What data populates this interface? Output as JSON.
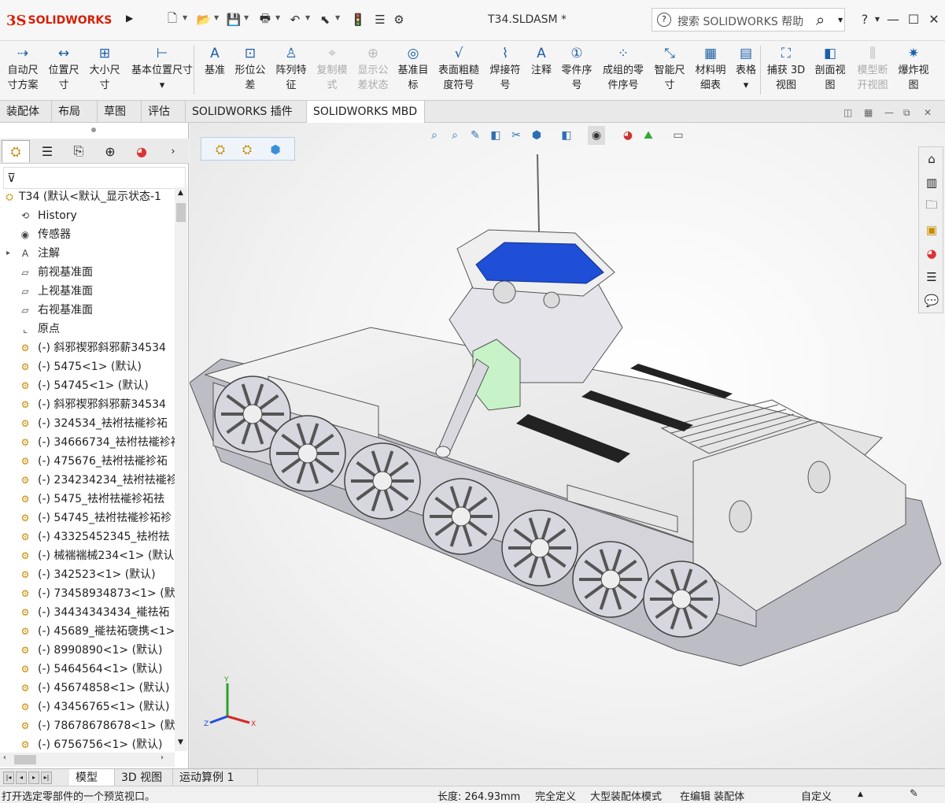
{
  "app": {
    "logo_ds": "3S",
    "logo_text": "SOLIDWORKS",
    "document_title": "T34.SLDASM *",
    "search_placeholder": "搜索 SOLIDWORKS 帮助",
    "help_label": "?"
  },
  "quick_access": [
    {
      "name": "new-document-icon",
      "glyph": "🗋"
    },
    {
      "name": "open-document-icon",
      "glyph": "📂"
    },
    {
      "name": "save-icon",
      "glyph": "💾"
    },
    {
      "name": "print-icon",
      "glyph": "🖶"
    },
    {
      "name": "undo-icon",
      "glyph": "↶"
    },
    {
      "name": "select-icon",
      "glyph": "⬉"
    },
    {
      "name": "rebuild-icon",
      "glyph": "🚦"
    },
    {
      "name": "file-properties-icon",
      "glyph": "☰"
    },
    {
      "name": "options-icon",
      "glyph": "⚙"
    }
  ],
  "commands": [
    {
      "l1": "自动尺",
      "l2": "寸方案",
      "icon": "auto-dimension-icon",
      "glyph": "⇢",
      "disabled": false
    },
    {
      "l1": "位置尺",
      "l2": "寸",
      "icon": "location-dimension-icon",
      "glyph": "↔",
      "disabled": false
    },
    {
      "l1": "大小尺",
      "l2": "寸",
      "icon": "size-dimension-icon",
      "glyph": "⊞",
      "disabled": false
    },
    {
      "l1": "基本位置尺寸",
      "l2": "▾",
      "icon": "basic-location-dimension-icon",
      "glyph": "⊢",
      "disabled": false
    },
    {
      "l1": "基准",
      "l2": "",
      "icon": "datum-icon",
      "glyph": "A",
      "disabled": false
    },
    {
      "l1": "形位公",
      "l2": "差",
      "icon": "geometric-tolerance-icon",
      "glyph": "⊡",
      "disabled": false
    },
    {
      "l1": "阵列特",
      "l2": "征",
      "icon": "pattern-feature-icon",
      "glyph": "♙",
      "disabled": false
    },
    {
      "l1": "复制模",
      "l2": "式",
      "icon": "copy-scheme-icon",
      "glyph": "⌖",
      "disabled": true
    },
    {
      "l1": "显示公",
      "l2": "差状态",
      "icon": "show-tolerance-status-icon",
      "glyph": "⊕",
      "disabled": true
    },
    {
      "l1": "基准目",
      "l2": "标",
      "icon": "datum-target-icon",
      "glyph": "◎",
      "disabled": false
    },
    {
      "l1": "表面粗糙",
      "l2": "度符号",
      "icon": "surface-finish-icon",
      "glyph": "√",
      "disabled": false
    },
    {
      "l1": "焊接符",
      "l2": "号",
      "icon": "weld-symbol-icon",
      "glyph": "⌇",
      "disabled": false
    },
    {
      "l1": "注释",
      "l2": "",
      "icon": "note-icon",
      "glyph": "A",
      "disabled": false
    },
    {
      "l1": "零件序",
      "l2": "号",
      "icon": "balloon-icon",
      "glyph": "①",
      "disabled": false
    },
    {
      "l1": "成组的零",
      "l2": "件序号",
      "icon": "stacked-balloon-icon",
      "glyph": "⁘",
      "disabled": false
    },
    {
      "l1": "智能尺",
      "l2": "寸",
      "icon": "smart-dimension-icon",
      "glyph": "⤡",
      "disabled": false
    },
    {
      "l1": "材料明",
      "l2": "细表",
      "icon": "bill-of-materials-icon",
      "glyph": "▦",
      "disabled": false
    },
    {
      "l1": "表格",
      "l2": "▾",
      "icon": "table-icon",
      "glyph": "▤",
      "disabled": false
    },
    {
      "l1": "捕获 3D",
      "l2": "视图",
      "icon": "capture-3d-view-icon",
      "glyph": "⛶",
      "disabled": false
    },
    {
      "l1": "剖面视",
      "l2": "图",
      "icon": "section-view-icon",
      "glyph": "◧",
      "disabled": false
    },
    {
      "l1": "模型断",
      "l2": "开视图",
      "icon": "model-break-view-icon",
      "glyph": "⫼",
      "disabled": true
    },
    {
      "l1": "爆炸视",
      "l2": "图",
      "icon": "explode-view-icon",
      "glyph": "✷",
      "disabled": false
    }
  ],
  "tabs": [
    "装配体",
    "布局",
    "草图",
    "评估",
    "SOLIDWORKS 插件",
    "SOLIDWORKS MBD"
  ],
  "tree": {
    "root": "T34 (默认<默认_显示状态-1",
    "items": [
      {
        "label": "History",
        "icon": "history-icon",
        "glyph": "⟲",
        "expandable": false
      },
      {
        "label": "传感器",
        "icon": "sensor-icon",
        "glyph": "◉",
        "expandable": false
      },
      {
        "label": "注解",
        "icon": "annotations-icon",
        "glyph": "A",
        "expandable": true
      },
      {
        "label": "前视基准面",
        "icon": "plane-icon",
        "glyph": "▱",
        "expandable": false
      },
      {
        "label": "上视基准面",
        "icon": "plane-icon",
        "glyph": "▱",
        "expandable": false
      },
      {
        "label": "右视基准面",
        "icon": "plane-icon",
        "glyph": "▱",
        "expandable": false
      },
      {
        "label": "原点",
        "icon": "origin-icon",
        "glyph": "⌞",
        "expandable": false
      },
      {
        "label": "(-) 斜邪禊邪斜邪薪34534",
        "icon": "part-icon",
        "glyph": "⚙",
        "expandable": false
      },
      {
        "label": "(-) 5475<1> (默认)",
        "icon": "part-icon",
        "glyph": "⚙",
        "expandable": false
      },
      {
        "label": "(-) 54745<1> (默认)",
        "icon": "part-icon",
        "glyph": "⚙",
        "expandable": false
      },
      {
        "label": "(-) 斜邪禊邪斜邪薪34534",
        "icon": "part-icon",
        "glyph": "⚙",
        "expandable": false
      },
      {
        "label": "(-) 324534_袪袝祛褦袗祏",
        "icon": "part-icon",
        "glyph": "⚙",
        "expandable": false
      },
      {
        "label": "(-) 34666734_袪袝祛褦袗祏",
        "icon": "part-icon",
        "glyph": "⚙",
        "expandable": false
      },
      {
        "label": "(-) 475676_袪袝祛褦袗祏",
        "icon": "part-icon",
        "glyph": "⚙",
        "expandable": false
      },
      {
        "label": "(-) 234234234_袪袝祛褦袗",
        "icon": "part-icon",
        "glyph": "⚙",
        "expandable": false
      },
      {
        "label": "(-) 5475_袪袝祛褦袗祏祛",
        "icon": "part-icon",
        "glyph": "⚙",
        "expandable": false
      },
      {
        "label": "(-) 54745_袪袝祛褦袗祏袗",
        "icon": "part-icon",
        "glyph": "⚙",
        "expandable": false
      },
      {
        "label": "(-) 43325452345_袪袝祛",
        "icon": "part-icon",
        "glyph": "⚙",
        "expandable": false
      },
      {
        "label": "(-) 械褍褍械234<1> (默认",
        "icon": "part-icon",
        "glyph": "⚙",
        "expandable": false
      },
      {
        "label": "(-) 342523<1> (默认)",
        "icon": "part-icon",
        "glyph": "⚙",
        "expandable": false
      },
      {
        "label": "(-) 73458934873<1> (默",
        "icon": "part-icon",
        "glyph": "⚙",
        "expandable": false
      },
      {
        "label": "(-) 34434343434_褦祛祏",
        "icon": "part-icon",
        "glyph": "⚙",
        "expandable": false
      },
      {
        "label": "(-) 45689_褦祛祏褏携<1>",
        "icon": "part-icon",
        "glyph": "⚙",
        "expandable": false
      },
      {
        "label": "(-) 8990890<1> (默认)",
        "icon": "part-icon",
        "glyph": "⚙",
        "expandable": false
      },
      {
        "label": "(-) 5464564<1> (默认)",
        "icon": "part-icon",
        "glyph": "⚙",
        "expandable": false
      },
      {
        "label": "(-) 45674858<1> (默认)",
        "icon": "part-icon",
        "glyph": "⚙",
        "expandable": false
      },
      {
        "label": "(-) 43456765<1> (默认)",
        "icon": "part-icon",
        "glyph": "⚙",
        "expandable": false
      },
      {
        "label": "(-) 78678678678<1> (默",
        "icon": "part-icon",
        "glyph": "⚙",
        "expandable": false
      },
      {
        "label": "(-) 6756756<1> (默认)",
        "icon": "part-icon",
        "glyph": "⚙",
        "expandable": false
      }
    ]
  },
  "bottom_tabs": [
    "模型",
    "3D 视图",
    "运动算例 1"
  ],
  "status": {
    "message": "打开选定零部件的一个预览视口。",
    "length": "长度: 264.93mm",
    "constraint": "完全定义",
    "mode": "大型装配体模式",
    "editing": "在编辑 装配体",
    "units": "自定义"
  },
  "colors": {
    "brand": "#d81e05",
    "selected_part": "#1f4fd6",
    "selected_part_alt": "#c8f2c8",
    "model_body": "#f2f2f2"
  }
}
